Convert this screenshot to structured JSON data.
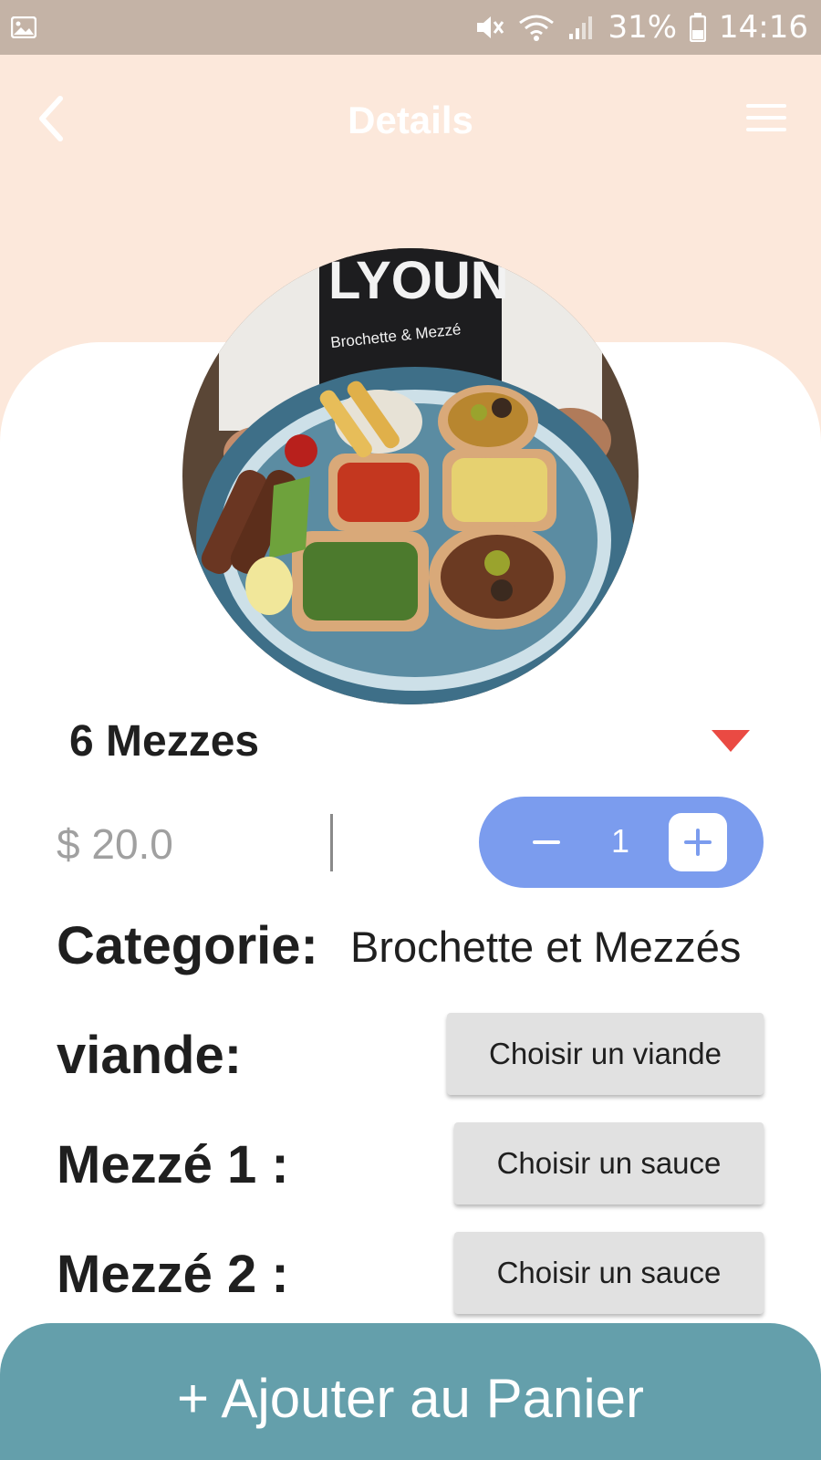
{
  "status_bar": {
    "battery": "31%",
    "time": "14:16"
  },
  "header": {
    "title": "Details"
  },
  "product": {
    "name": "6 Mezzes",
    "price": "$ 20.0",
    "quantity": "1",
    "category_label": "Categorie:",
    "category_value": "Brochette et Mezzés",
    "photo_apron_text": "Brochette & Mezzé"
  },
  "options": [
    {
      "label": "viande:",
      "button": "Choisir un viande"
    },
    {
      "label": "Mezzé 1 :",
      "button": "Choisir un sauce"
    },
    {
      "label": "Mezzé 2 :",
      "button": "Choisir un sauce"
    }
  ],
  "actions": {
    "add_to_cart": "+ Ajouter au Panier"
  },
  "colors": {
    "status_bar": "#c4b3a6",
    "header_bg": "#fce8db",
    "stepper": "#7b9cee",
    "cart_button": "#649fab",
    "favorite": "#ea4a43"
  },
  "icons": [
    "gallery-icon",
    "mute-icon",
    "wifi-icon",
    "signal-icon",
    "battery-icon",
    "back-arrow-icon",
    "menu-icon",
    "heart-icon",
    "minus-icon",
    "plus-icon"
  ]
}
